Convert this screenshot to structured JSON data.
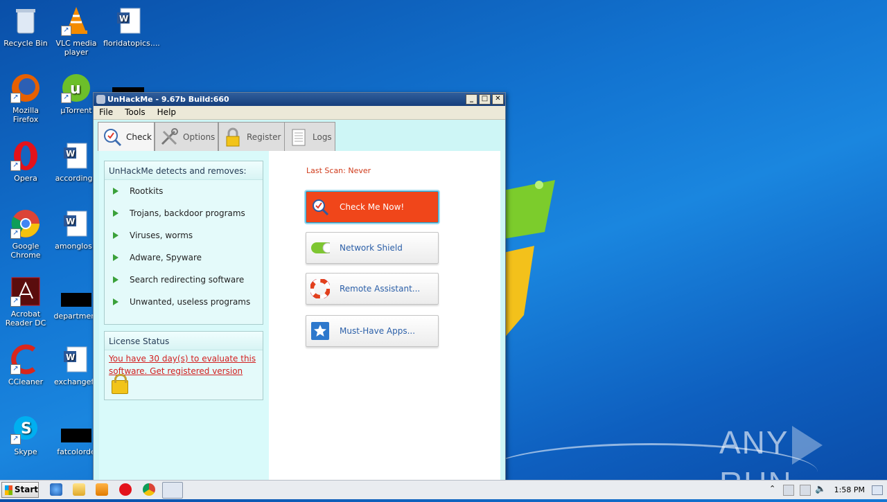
{
  "desktop": {
    "icons": [
      {
        "label": "Recycle Bin"
      },
      {
        "label": "VLC media player"
      },
      {
        "label": "floridatopics...."
      },
      {
        "label": "Mozilla Firefox"
      },
      {
        "label": "µTorrent"
      },
      {
        "label": "Opera"
      },
      {
        "label": "accordingb"
      },
      {
        "label": "Google Chrome"
      },
      {
        "label": "amonglos.r"
      },
      {
        "label": "Acrobat Reader DC"
      },
      {
        "label": "department"
      },
      {
        "label": "CCleaner"
      },
      {
        "label": "exchangefo"
      },
      {
        "label": "Skype"
      },
      {
        "label": "fatcolorde"
      }
    ],
    "watermark": {
      "left": "ANY",
      "right": "RUN"
    }
  },
  "window": {
    "title": "UnHackMe - 9.67b Build:660",
    "controls": {
      "minimize": "_",
      "maximize": "□",
      "close": "✕"
    },
    "menu": [
      {
        "label": "File"
      },
      {
        "label": "Tools"
      },
      {
        "label": "Help"
      }
    ],
    "tabs": [
      {
        "label": "Check",
        "icon": "magnifier-check-icon",
        "active": true
      },
      {
        "label": "Options",
        "icon": "tools-icon"
      },
      {
        "label": "Register",
        "icon": "padlock-icon"
      },
      {
        "label": "Logs",
        "icon": "log-list-icon"
      }
    ],
    "detects": {
      "heading": "UnHackMe detects and removes:",
      "items": [
        "Rootkits",
        "Trojans, backdoor programs",
        "Viruses, worms",
        "Adware, Spyware",
        "Search redirecting software",
        "Unwanted, useless programs"
      ]
    },
    "license": {
      "heading": "License Status",
      "line1": "You have 30 day(s) to evaluate this ",
      "line2": "software. Get registered version "
    },
    "last_scan": "Last Scan: Never",
    "actions": [
      {
        "label": "Check Me Now!",
        "icon": "magnifier-check-icon"
      },
      {
        "label": "Network Shield",
        "icon": "toggle-on-icon"
      },
      {
        "label": "Remote Assistant...",
        "icon": "lifebuoy-icon"
      },
      {
        "label": "Must-Have Apps...",
        "icon": "star-icon"
      }
    ]
  },
  "taskbar": {
    "start_label": "Start",
    "clock": "1:58 PM"
  },
  "colors": {
    "accent_orange": "#f0461a",
    "link_red": "#d21f1f",
    "pane_cyan": "#cef6f6",
    "titlebar": "#1f4a86"
  }
}
